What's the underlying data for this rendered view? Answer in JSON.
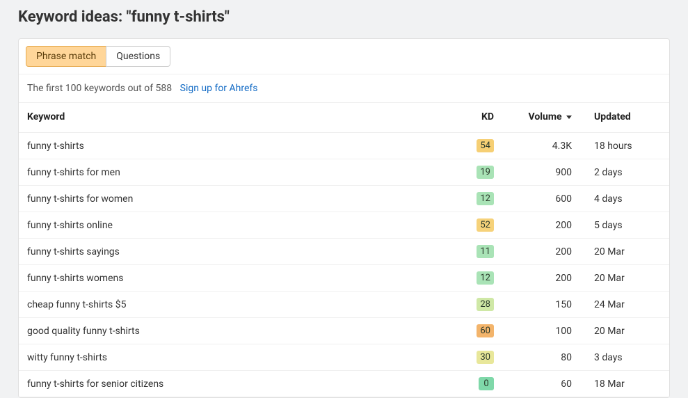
{
  "title": "Keyword ideas: \"funny t-shirts\"",
  "tabs": [
    {
      "label": "Phrase match",
      "active": true
    },
    {
      "label": "Questions",
      "active": false
    }
  ],
  "infobar": {
    "text": "The first 100 keywords out of 588",
    "link": "Sign up for Ahrefs"
  },
  "columns": {
    "keyword": "Keyword",
    "kd": "KD",
    "volume": "Volume",
    "updated": "Updated"
  },
  "kd_colors": {
    "0": "#7fd8a9",
    "11": "#a9e3b6",
    "12": "#a9e3b6",
    "19": "#a9e3b6",
    "28": "#cfe8a6",
    "30": "#e8e79a",
    "52": "#f6d27a",
    "54": "#f6cf74",
    "60": "#f3b46b"
  },
  "rows": [
    {
      "keyword": "funny t-shirts",
      "kd": 54,
      "volume": "4.3K",
      "updated": "18 hours"
    },
    {
      "keyword": "funny t-shirts for men",
      "kd": 19,
      "volume": "900",
      "updated": "2 days"
    },
    {
      "keyword": "funny t-shirts for women",
      "kd": 12,
      "volume": "600",
      "updated": "4 days"
    },
    {
      "keyword": "funny t-shirts online",
      "kd": 52,
      "volume": "200",
      "updated": "5 days"
    },
    {
      "keyword": "funny t-shirts sayings",
      "kd": 11,
      "volume": "200",
      "updated": "20 Mar"
    },
    {
      "keyword": "funny t-shirts womens",
      "kd": 12,
      "volume": "200",
      "updated": "20 Mar"
    },
    {
      "keyword": "cheap funny t-shirts $5",
      "kd": 28,
      "volume": "150",
      "updated": "24 Mar"
    },
    {
      "keyword": "good quality funny t-shirts",
      "kd": 60,
      "volume": "100",
      "updated": "20 Mar"
    },
    {
      "keyword": "witty funny t-shirts",
      "kd": 30,
      "volume": "80",
      "updated": "3 days"
    },
    {
      "keyword": "funny t-shirts for senior citizens",
      "kd": 0,
      "volume": "60",
      "updated": "18 Mar"
    }
  ]
}
